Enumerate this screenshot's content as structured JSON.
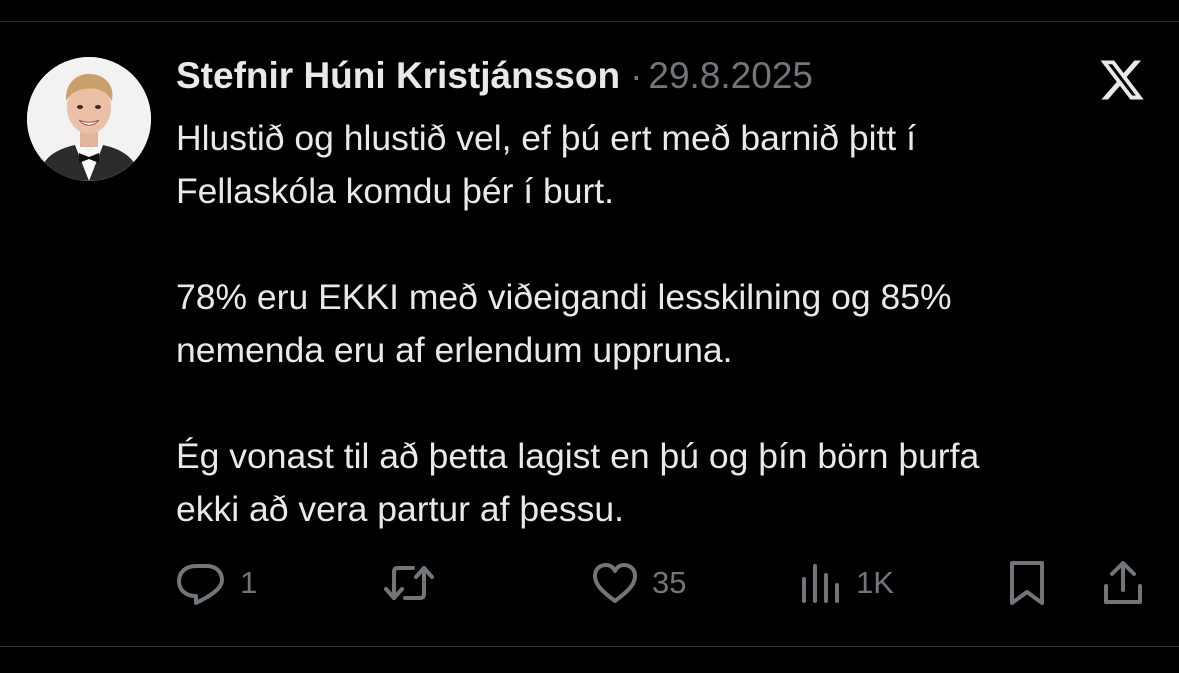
{
  "tweet": {
    "author_name": "Stefnir Húni Kristjánsson",
    "separator": "·",
    "date": "29.8.2025",
    "paragraphs": [
      "Hlustið og hlustið vel, ef þú ert með barnið þitt í\nFellaskóla komdu þér í burt.",
      "78% eru EKKI með viðeigandi lesskilning og 85%\nnemenda eru af erlendum uppruna.",
      "Ég vonast til að þetta lagist en þú og þín börn þurfa\nekki að vera partur af þessu."
    ]
  },
  "actions": {
    "reply": {
      "icon": "reply-icon",
      "count": "1"
    },
    "repost": {
      "icon": "repost-icon",
      "count": ""
    },
    "like": {
      "icon": "heart-icon",
      "count": "35"
    },
    "views": {
      "icon": "views-icon",
      "count": "1K"
    },
    "bookmark": {
      "icon": "bookmark-icon"
    },
    "share": {
      "icon": "share-icon"
    }
  },
  "colors": {
    "background": "#000000",
    "text": "#e7e9ea",
    "muted": "#71767b",
    "divider": "#2f3336"
  }
}
